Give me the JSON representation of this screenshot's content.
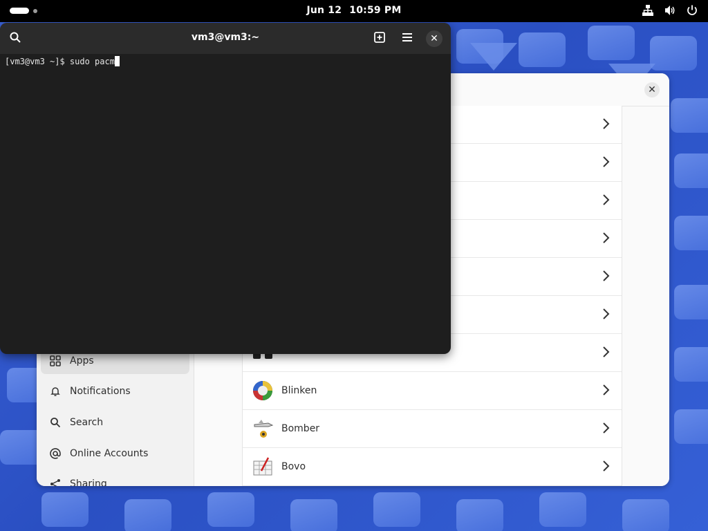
{
  "topbar": {
    "date": "Jun 12",
    "time": "10:59 PM",
    "icons": [
      "network-icon",
      "volume-icon",
      "power-icon"
    ]
  },
  "terminal": {
    "title": "vm3@vm3:~",
    "prompt": "[vm3@vm3 ~]$ ",
    "command": "sudo pacm",
    "buttons": [
      "search-icon",
      "new-tab-icon",
      "menu-icon",
      "close-icon"
    ]
  },
  "settings": {
    "sidebar": {
      "items": [
        {
          "label": "Apps",
          "icon": "apps-grid-icon",
          "active": true
        },
        {
          "label": "Notifications",
          "icon": "bell-icon",
          "active": false
        },
        {
          "label": "Search",
          "icon": "search-icon",
          "active": false
        },
        {
          "label": "Online Accounts",
          "icon": "at-icon",
          "active": false
        },
        {
          "label": "Sharing",
          "icon": "share-icon",
          "active": false
        }
      ]
    },
    "apps": [
      {
        "name": ""
      },
      {
        "name": ""
      },
      {
        "name": ""
      },
      {
        "name": ""
      },
      {
        "name": ""
      },
      {
        "name": ""
      },
      {
        "name": ""
      },
      {
        "name": "Blinken",
        "icon": "blinken-app-icon"
      },
      {
        "name": "Bomber",
        "icon": "bomber-app-icon"
      },
      {
        "name": "Bovo",
        "icon": "bovo-app-icon"
      }
    ]
  }
}
